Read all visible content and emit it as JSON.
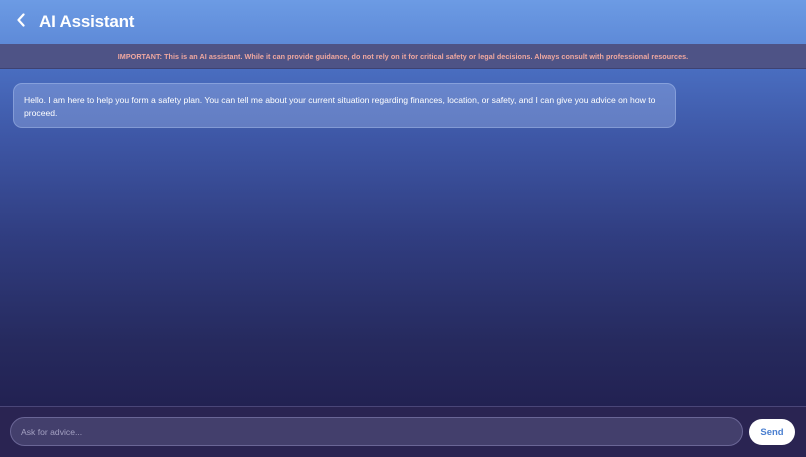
{
  "header": {
    "title": "AI Assistant",
    "back_icon": "chevron-left-icon"
  },
  "banner": {
    "text": "IMPORTANT: This is an AI assistant. While it can provide guidance, do not rely on it for critical safety or legal decisions. Always consult with professional resources."
  },
  "messages": [
    {
      "sender": "assistant",
      "text": "Hello. I am here to help you form a safety plan. You can tell me about your current situation regarding finances, location, or safety, and I can give you advice on how to proceed."
    }
  ],
  "composer": {
    "placeholder": "Ask for advice...",
    "value": "",
    "send_label": "Send"
  },
  "colors": {
    "header_bg": "#6c9be4",
    "banner_bg": "#4e5386",
    "banner_text": "#f0a8a0",
    "send_text": "#4a7fd0"
  }
}
